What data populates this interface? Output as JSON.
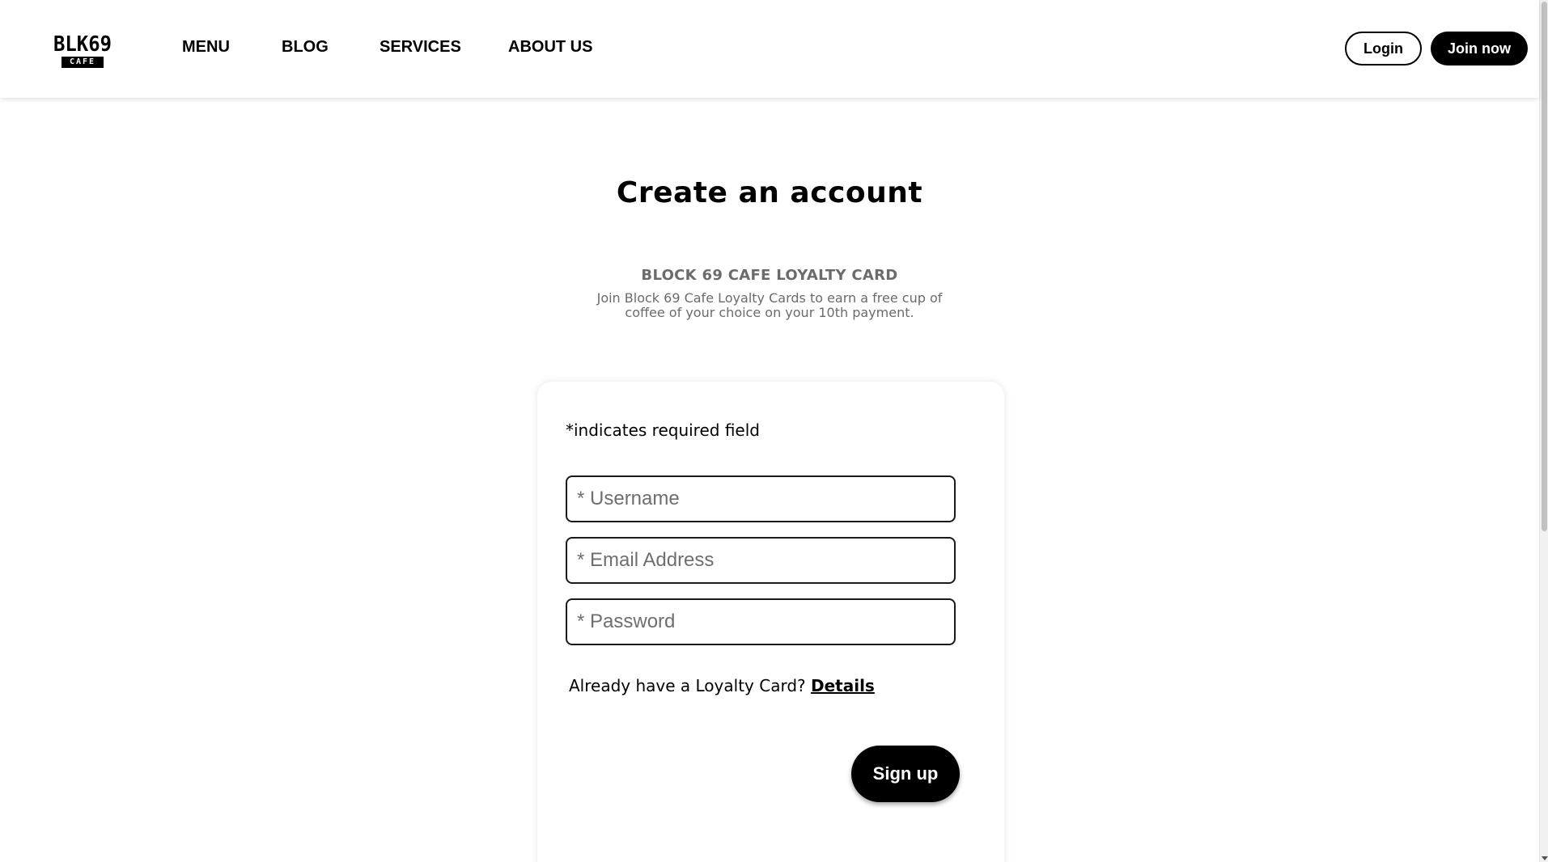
{
  "header": {
    "logo": {
      "top": "BLK69",
      "bottom": "CAFE"
    },
    "nav": [
      {
        "label": "MENU"
      },
      {
        "label": "BLOG"
      },
      {
        "label": "SERVICES"
      },
      {
        "label": "ABOUT US"
      }
    ],
    "login_label": "Login",
    "join_label": "Join now"
  },
  "main": {
    "title": "Create an account",
    "loyalty_heading": "BLOCK 69 CAFE LOYALTY CARD",
    "loyalty_desc": "Join Block 69 Cafe Loyalty Cards to earn a free cup of coffee of your choice on your 10th payment."
  },
  "form": {
    "required_note": "*indicates required field",
    "username": {
      "placeholder": "* Username",
      "value": ""
    },
    "email": {
      "placeholder": "* Email Address",
      "value": ""
    },
    "password": {
      "placeholder": "* Password",
      "value": ""
    },
    "already_text": "Already have a Loyalty Card?",
    "details_label": "Details",
    "signup_label": "Sign up"
  },
  "colors": {
    "primary": "#000000",
    "muted_text": "#6b6b6b",
    "background": "#ffffff"
  }
}
